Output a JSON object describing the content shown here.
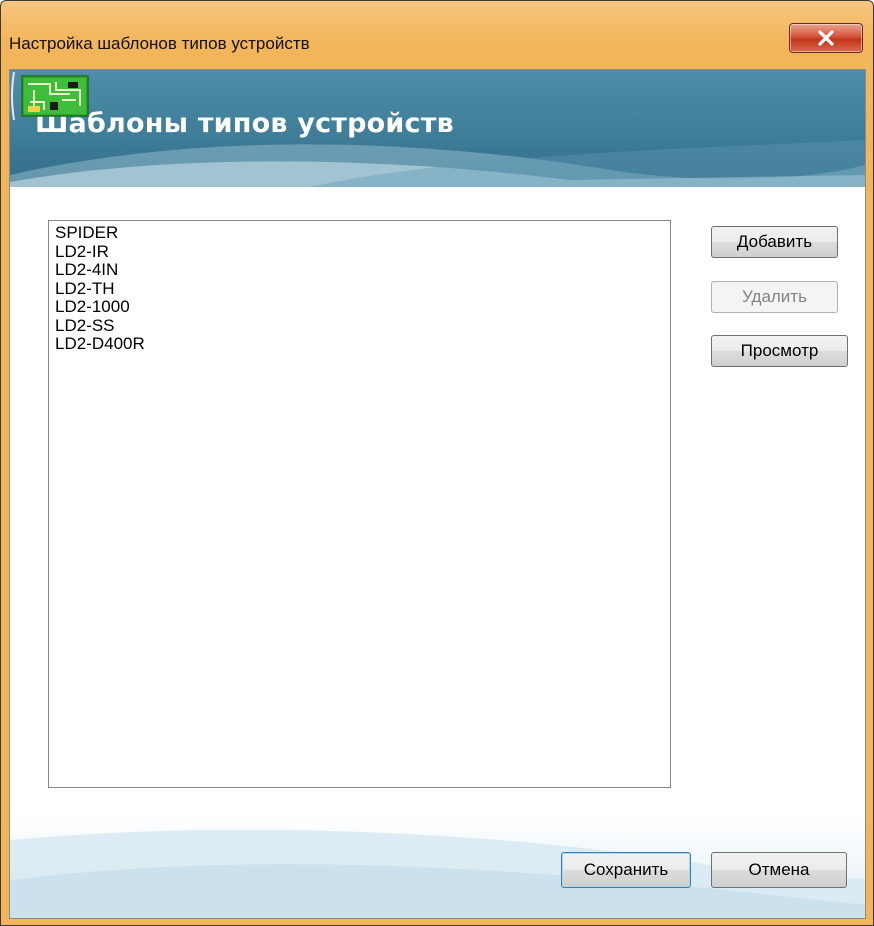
{
  "window": {
    "title": "Настройка шаблонов типов устройств",
    "close_glyph": "X"
  },
  "banner": {
    "title": "Шаблоны типов устройств",
    "icon": "circuit-board-icon"
  },
  "list": {
    "items": [
      "SPIDER",
      "LD2-IR",
      "LD2-4IN",
      "LD2-TH",
      "LD2-1000",
      "LD2-SS",
      "LD2-D400R"
    ]
  },
  "buttons": {
    "add": "Добавить",
    "delete": "Удалить",
    "view": "Просмотр",
    "save": "Сохранить",
    "cancel": "Отмена"
  },
  "colors": {
    "frame": "#f2b55a",
    "banner": "#3f7d99",
    "close": "#c2361b",
    "icon_green": "#2fa62c"
  }
}
